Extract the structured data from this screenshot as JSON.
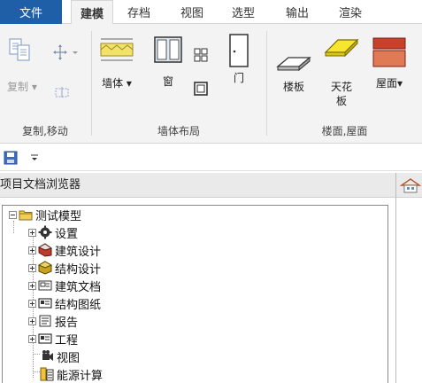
{
  "tabs": [
    "文件",
    "建模",
    "存档",
    "视图",
    "选型",
    "输出",
    "渲染"
  ],
  "ribbon": {
    "copy_group": {
      "label": "复制,移动",
      "copy_label": "复制"
    },
    "wall_group": {
      "label": "墙体布局",
      "wall_label": "墙体",
      "window_label": "窗",
      "door_label": "门"
    },
    "floor_group": {
      "label": "楼面,屋面",
      "floor_label": "楼板",
      "skylight_label_1": "天花",
      "skylight_label_2": "板",
      "roof_label": "屋面"
    }
  },
  "panel": {
    "title": "项目文档浏览器",
    "root": "测试模型",
    "items": [
      "设置",
      "建筑设计",
      "结构设计",
      "建筑文档",
      "结构图纸",
      "报告",
      "工程",
      "视图",
      "能源计算"
    ]
  },
  "colors": {
    "file_tab": "#1f5fa8",
    "ribbon_bg": "#f3f3f3",
    "wall_yellow": "#f2e26a",
    "roof_red": "#d2502e"
  }
}
